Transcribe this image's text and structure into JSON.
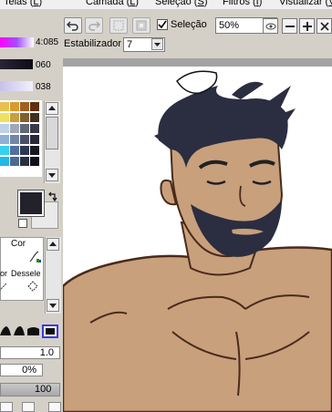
{
  "menu": {
    "items": [
      {
        "label": "Telas (",
        "key": "L",
        "tail": ")"
      },
      {
        "label": "Camada (",
        "key": "L",
        "tail": ")"
      },
      {
        "label": "Seleção (",
        "key": "S",
        "tail": ")"
      },
      {
        "label": "Filtros (",
        "key": "I",
        "tail": ")"
      },
      {
        "label": "Visualizar (",
        "key": "V",
        "tail": ")"
      }
    ]
  },
  "toolbar": {
    "selection_label": "Seleção",
    "selection_checked": true,
    "zoom_value": "50%",
    "stabilizer_label": "Estabilizador",
    "stabilizer_value": "7"
  },
  "left_panel": {
    "slider_values": [
      "4:085",
      "060",
      "038"
    ],
    "tool_labels": [
      "Cor",
      "Dessele",
      "or"
    ],
    "brush_size": "1.0",
    "opacity": "0%",
    "density": "100"
  },
  "colors": {
    "foreground": "#23222a",
    "background": "#e9e9e9",
    "skin": "#c8a07c",
    "outline": "#4a2a1a",
    "hair": "#2b2d40",
    "accent": "#3a3adc"
  },
  "icons": [
    "undo-icon",
    "redo-icon",
    "deselect-icon",
    "invert-selection-icon",
    "eye-icon",
    "zoom-out-icon",
    "zoom-in-icon",
    "reset-zoom-icon",
    "dropdown-arrow-icon",
    "swap-colors-icon",
    "scroll-up-icon",
    "scroll-down-icon"
  ]
}
